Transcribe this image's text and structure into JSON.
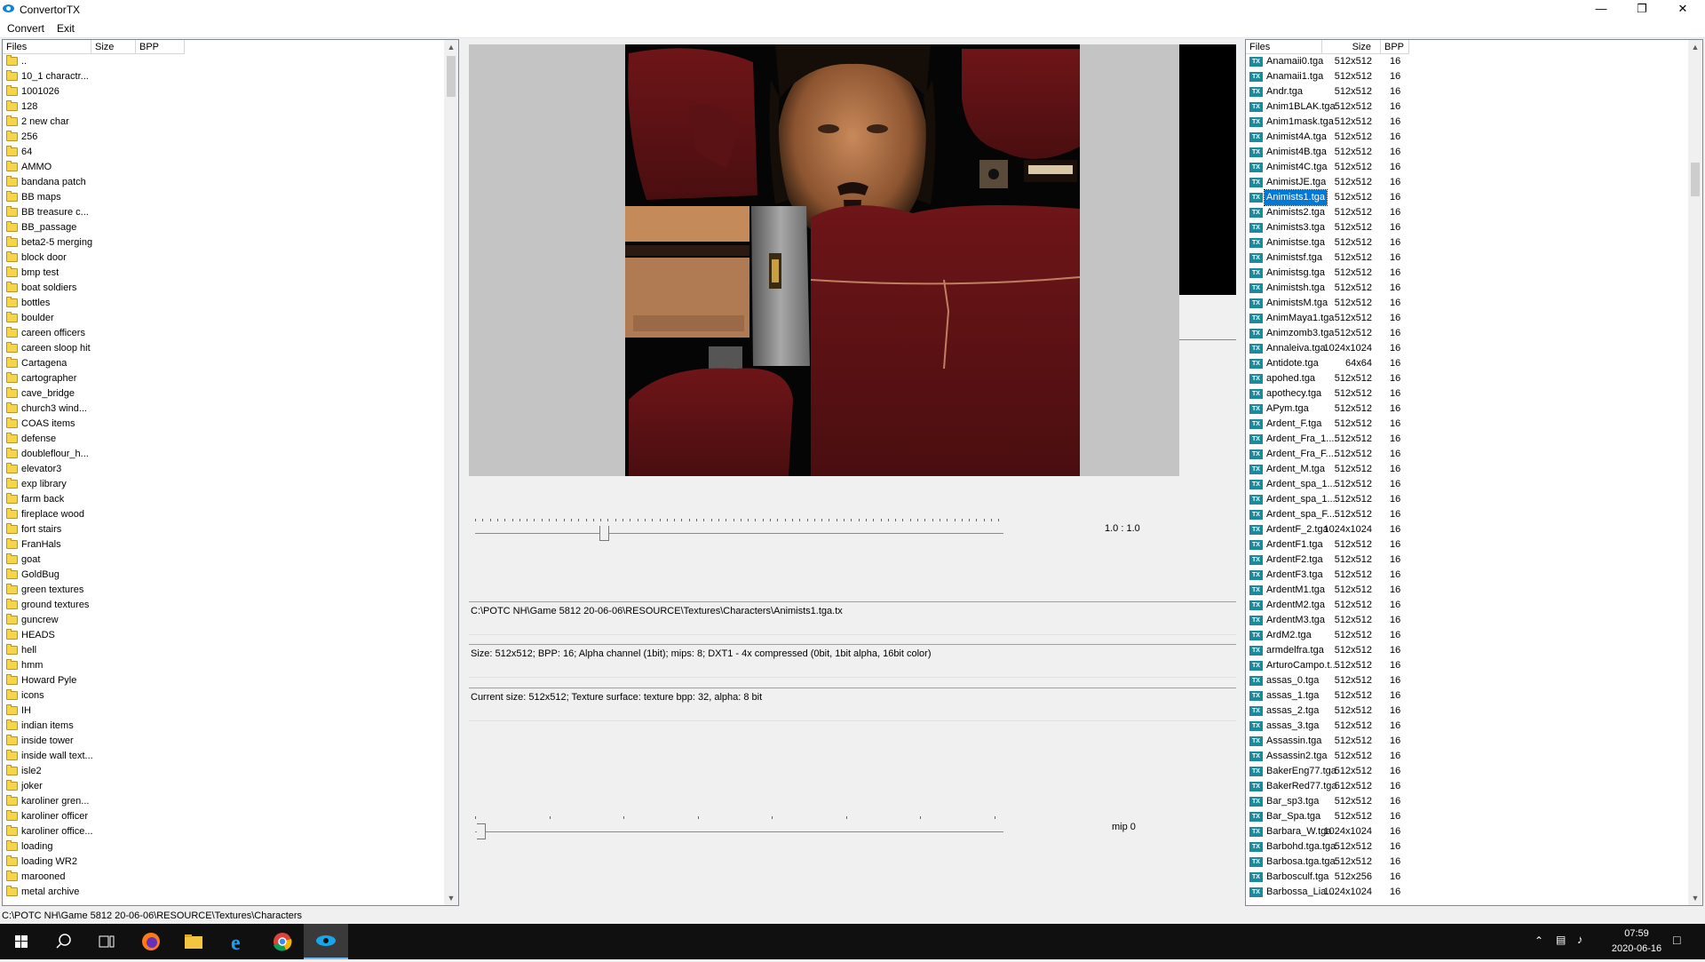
{
  "window": {
    "title": "ConvertorTX"
  },
  "menu": {
    "convert": "Convert",
    "exit": "Exit"
  },
  "left_pane": {
    "columns": [
      "Files",
      "Size",
      "BPP"
    ],
    "items": [
      "..",
      "10_1 charactr...",
      "1001026",
      "128",
      "2 new char",
      "256",
      "64",
      "AMMO",
      "bandana patch",
      "BB maps",
      "BB treasure c...",
      "BB_passage",
      "beta2-5 merging",
      "block door",
      "bmp test",
      "boat soldiers",
      "bottles",
      "boulder",
      "careen officers",
      "careen sloop hit",
      "Cartagena",
      "cartographer",
      "cave_bridge",
      "church3 wind...",
      "COAS items",
      "defense",
      "doubleflour_h...",
      "elevator3",
      "exp library",
      "farm back",
      "fireplace wood",
      "fort stairs",
      "FranHals",
      "goat",
      "GoldBug",
      "green textures",
      "ground textures",
      "guncrew",
      "HEADS",
      "hell",
      "hmm",
      "Howard Pyle",
      "icons",
      "IH",
      "indian items",
      "inside tower",
      "inside wall text...",
      "isle2",
      "joker",
      "karoliner gren...",
      "karoliner officer",
      "karoliner office...",
      "loading",
      "loading WR2",
      "marooned",
      "metal archive"
    ]
  },
  "zoom_label": "1.0 : 1.0",
  "mip_label": "mip 0",
  "info": {
    "path": "C:\\POTC NH\\Game 5812 20-06-06\\RESOURCE\\Textures\\Characters\\Animists1.tga.tx",
    "details": "Size: 512x512; BPP: 16; Alpha channel (1bit); mips: 8; DXT1 - 4x compressed (0bit, 1bit alpha, 16bit color)",
    "current": "Current size: 512x512; Texture surface: texture bpp: 32, alpha: 8 bit"
  },
  "right_pane": {
    "columns": [
      "Files",
      "Size",
      "BPP"
    ],
    "selected": "Animists1.tga",
    "files": [
      [
        "Anamaii0.tga",
        "512x512",
        "16"
      ],
      [
        "Anamaii1.tga",
        "512x512",
        "16"
      ],
      [
        "Andr.tga",
        "512x512",
        "16"
      ],
      [
        "Anim1BLAK.tga",
        "512x512",
        "16"
      ],
      [
        "Anim1mask.tga",
        "512x512",
        "16"
      ],
      [
        "Animist4A.tga",
        "512x512",
        "16"
      ],
      [
        "Animist4B.tga",
        "512x512",
        "16"
      ],
      [
        "Animist4C.tga",
        "512x512",
        "16"
      ],
      [
        "AnimistJE.tga",
        "512x512",
        "16"
      ],
      [
        "Animists1.tga",
        "512x512",
        "16"
      ],
      [
        "Animists2.tga",
        "512x512",
        "16"
      ],
      [
        "Animists3.tga",
        "512x512",
        "16"
      ],
      [
        "Animistse.tga",
        "512x512",
        "16"
      ],
      [
        "Animistsf.tga",
        "512x512",
        "16"
      ],
      [
        "Animistsg.tga",
        "512x512",
        "16"
      ],
      [
        "Animistsh.tga",
        "512x512",
        "16"
      ],
      [
        "AnimistsM.tga",
        "512x512",
        "16"
      ],
      [
        "AnimMaya1.tga",
        "512x512",
        "16"
      ],
      [
        "Animzomb3.tga",
        "512x512",
        "16"
      ],
      [
        "Annaleiva.tga",
        "1024x1024",
        "16"
      ],
      [
        "Antidote.tga",
        "64x64",
        "16"
      ],
      [
        "apohed.tga",
        "512x512",
        "16"
      ],
      [
        "apothecy.tga",
        "512x512",
        "16"
      ],
      [
        "APym.tga",
        "512x512",
        "16"
      ],
      [
        "Ardent_F.tga",
        "512x512",
        "16"
      ],
      [
        "Ardent_Fra_1....",
        "512x512",
        "16"
      ],
      [
        "Ardent_Fra_F....",
        "512x512",
        "16"
      ],
      [
        "Ardent_M.tga",
        "512x512",
        "16"
      ],
      [
        "Ardent_spa_1....",
        "512x512",
        "16"
      ],
      [
        "Ardent_spa_1....",
        "512x512",
        "16"
      ],
      [
        "Ardent_spa_F....",
        "512x512",
        "16"
      ],
      [
        "ArdentF_2.tga",
        "1024x1024",
        "16"
      ],
      [
        "ArdentF1.tga",
        "512x512",
        "16"
      ],
      [
        "ArdentF2.tga",
        "512x512",
        "16"
      ],
      [
        "ArdentF3.tga",
        "512x512",
        "16"
      ],
      [
        "ArdentM1.tga",
        "512x512",
        "16"
      ],
      [
        "ArdentM2.tga",
        "512x512",
        "16"
      ],
      [
        "ArdentM3.tga",
        "512x512",
        "16"
      ],
      [
        "ArdM2.tga",
        "512x512",
        "16"
      ],
      [
        "armdelfra.tga",
        "512x512",
        "16"
      ],
      [
        "ArturoCampo.t...",
        "512x512",
        "16"
      ],
      [
        "assas_0.tga",
        "512x512",
        "16"
      ],
      [
        "assas_1.tga",
        "512x512",
        "16"
      ],
      [
        "assas_2.tga",
        "512x512",
        "16"
      ],
      [
        "assas_3.tga",
        "512x512",
        "16"
      ],
      [
        "Assassin.tga",
        "512x512",
        "16"
      ],
      [
        "Assassin2.tga",
        "512x512",
        "16"
      ],
      [
        "BakerEng77.tga",
        "512x512",
        "16"
      ],
      [
        "BakerRed77.tga",
        "512x512",
        "16"
      ],
      [
        "Bar_sp3.tga",
        "512x512",
        "16"
      ],
      [
        "Bar_Spa.tga",
        "512x512",
        "16"
      ],
      [
        "Barbara_W.tga",
        "1024x1024",
        "16"
      ],
      [
        "Barbohd.tga.tga",
        "512x512",
        "16"
      ],
      [
        "Barbosa.tga.tga",
        "512x512",
        "16"
      ],
      [
        "Barbosculf.tga",
        "512x256",
        "16"
      ],
      [
        "Barbossa_Lia...",
        "1024x1024",
        "16"
      ]
    ]
  },
  "status": "C:\\POTC NH\\Game 5812 20-06-06\\RESOURCE\\Textures\\Characters",
  "taskbar": {
    "time": "07:59",
    "date": "2020-06-16"
  },
  "colors": {
    "selection": "#0078d7",
    "tx_icon": "#1c8a9e",
    "folder": "#f7d54a",
    "taskbar": "#101010"
  }
}
